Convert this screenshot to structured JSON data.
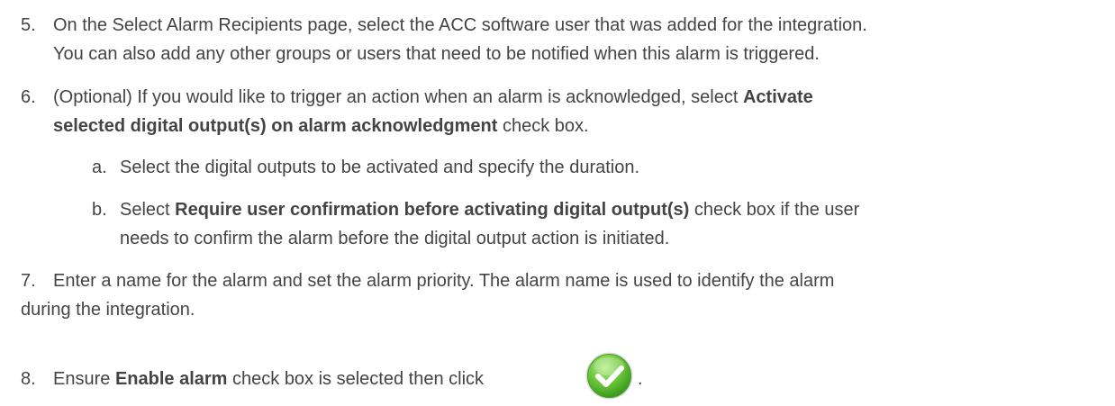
{
  "steps": [
    {
      "number": "5.",
      "line1": "On the Select Alarm Recipients page, select the ACC software user that was added for the integration.",
      "line2": "You can also add any other groups or users that need to be notified when this alarm is triggered."
    },
    {
      "number": "6.",
      "lead": "(Optional) If you would like to trigger an action when an alarm is acknowledged, select ",
      "bold1": "Activate",
      "bold2": "selected digital output(s) on alarm acknowledgment",
      "tail": " check box.",
      "substeps": [
        {
          "letter": "a.",
          "text": "Select the digital outputs to be activated and specify the duration."
        },
        {
          "letter": "b.",
          "lead": "Select ",
          "bold": "Require user confirmation before activating digital output(s)",
          "tail": " check box if the user",
          "line2": "needs to confirm the alarm before the digital output action is initiated."
        }
      ]
    },
    {
      "number": "7.",
      "line1": "Enter a name for the alarm and set the alarm priority. The alarm name is used to identify the alarm",
      "line2": "during the integration."
    },
    {
      "number": "8.",
      "lead": "Ensure ",
      "bold": "Enable alarm",
      "tail": " check box is selected then click",
      "end": ".",
      "icon": "checkmark-confirm-icon"
    }
  ],
  "colors": {
    "text": "#444444",
    "icon_green_light": "#8fdc5a",
    "icon_green_dark": "#3a9a1c"
  }
}
